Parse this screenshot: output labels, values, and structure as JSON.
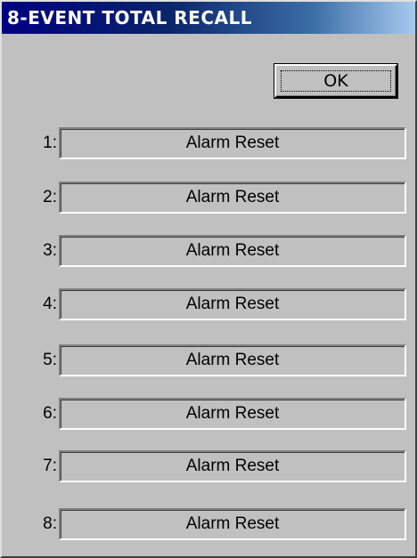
{
  "window": {
    "title": "8-EVENT TOTAL RECALL"
  },
  "ok_button": {
    "label": "OK"
  },
  "events": [
    {
      "number": "1:",
      "value": "Alarm Reset"
    },
    {
      "number": "2:",
      "value": "Alarm Reset"
    },
    {
      "number": "3:",
      "value": "Alarm Reset"
    },
    {
      "number": "4:",
      "value": "Alarm Reset"
    },
    {
      "number": "5:",
      "value": "Alarm Reset"
    },
    {
      "number": "6:",
      "value": "Alarm Reset"
    },
    {
      "number": "7:",
      "value": "Alarm Reset"
    },
    {
      "number": "8:",
      "value": "Alarm Reset"
    }
  ],
  "colors": {
    "title_bar_start": "#000080",
    "title_bar_end": "#a6caf0",
    "window_face": "#c0c0c0"
  }
}
